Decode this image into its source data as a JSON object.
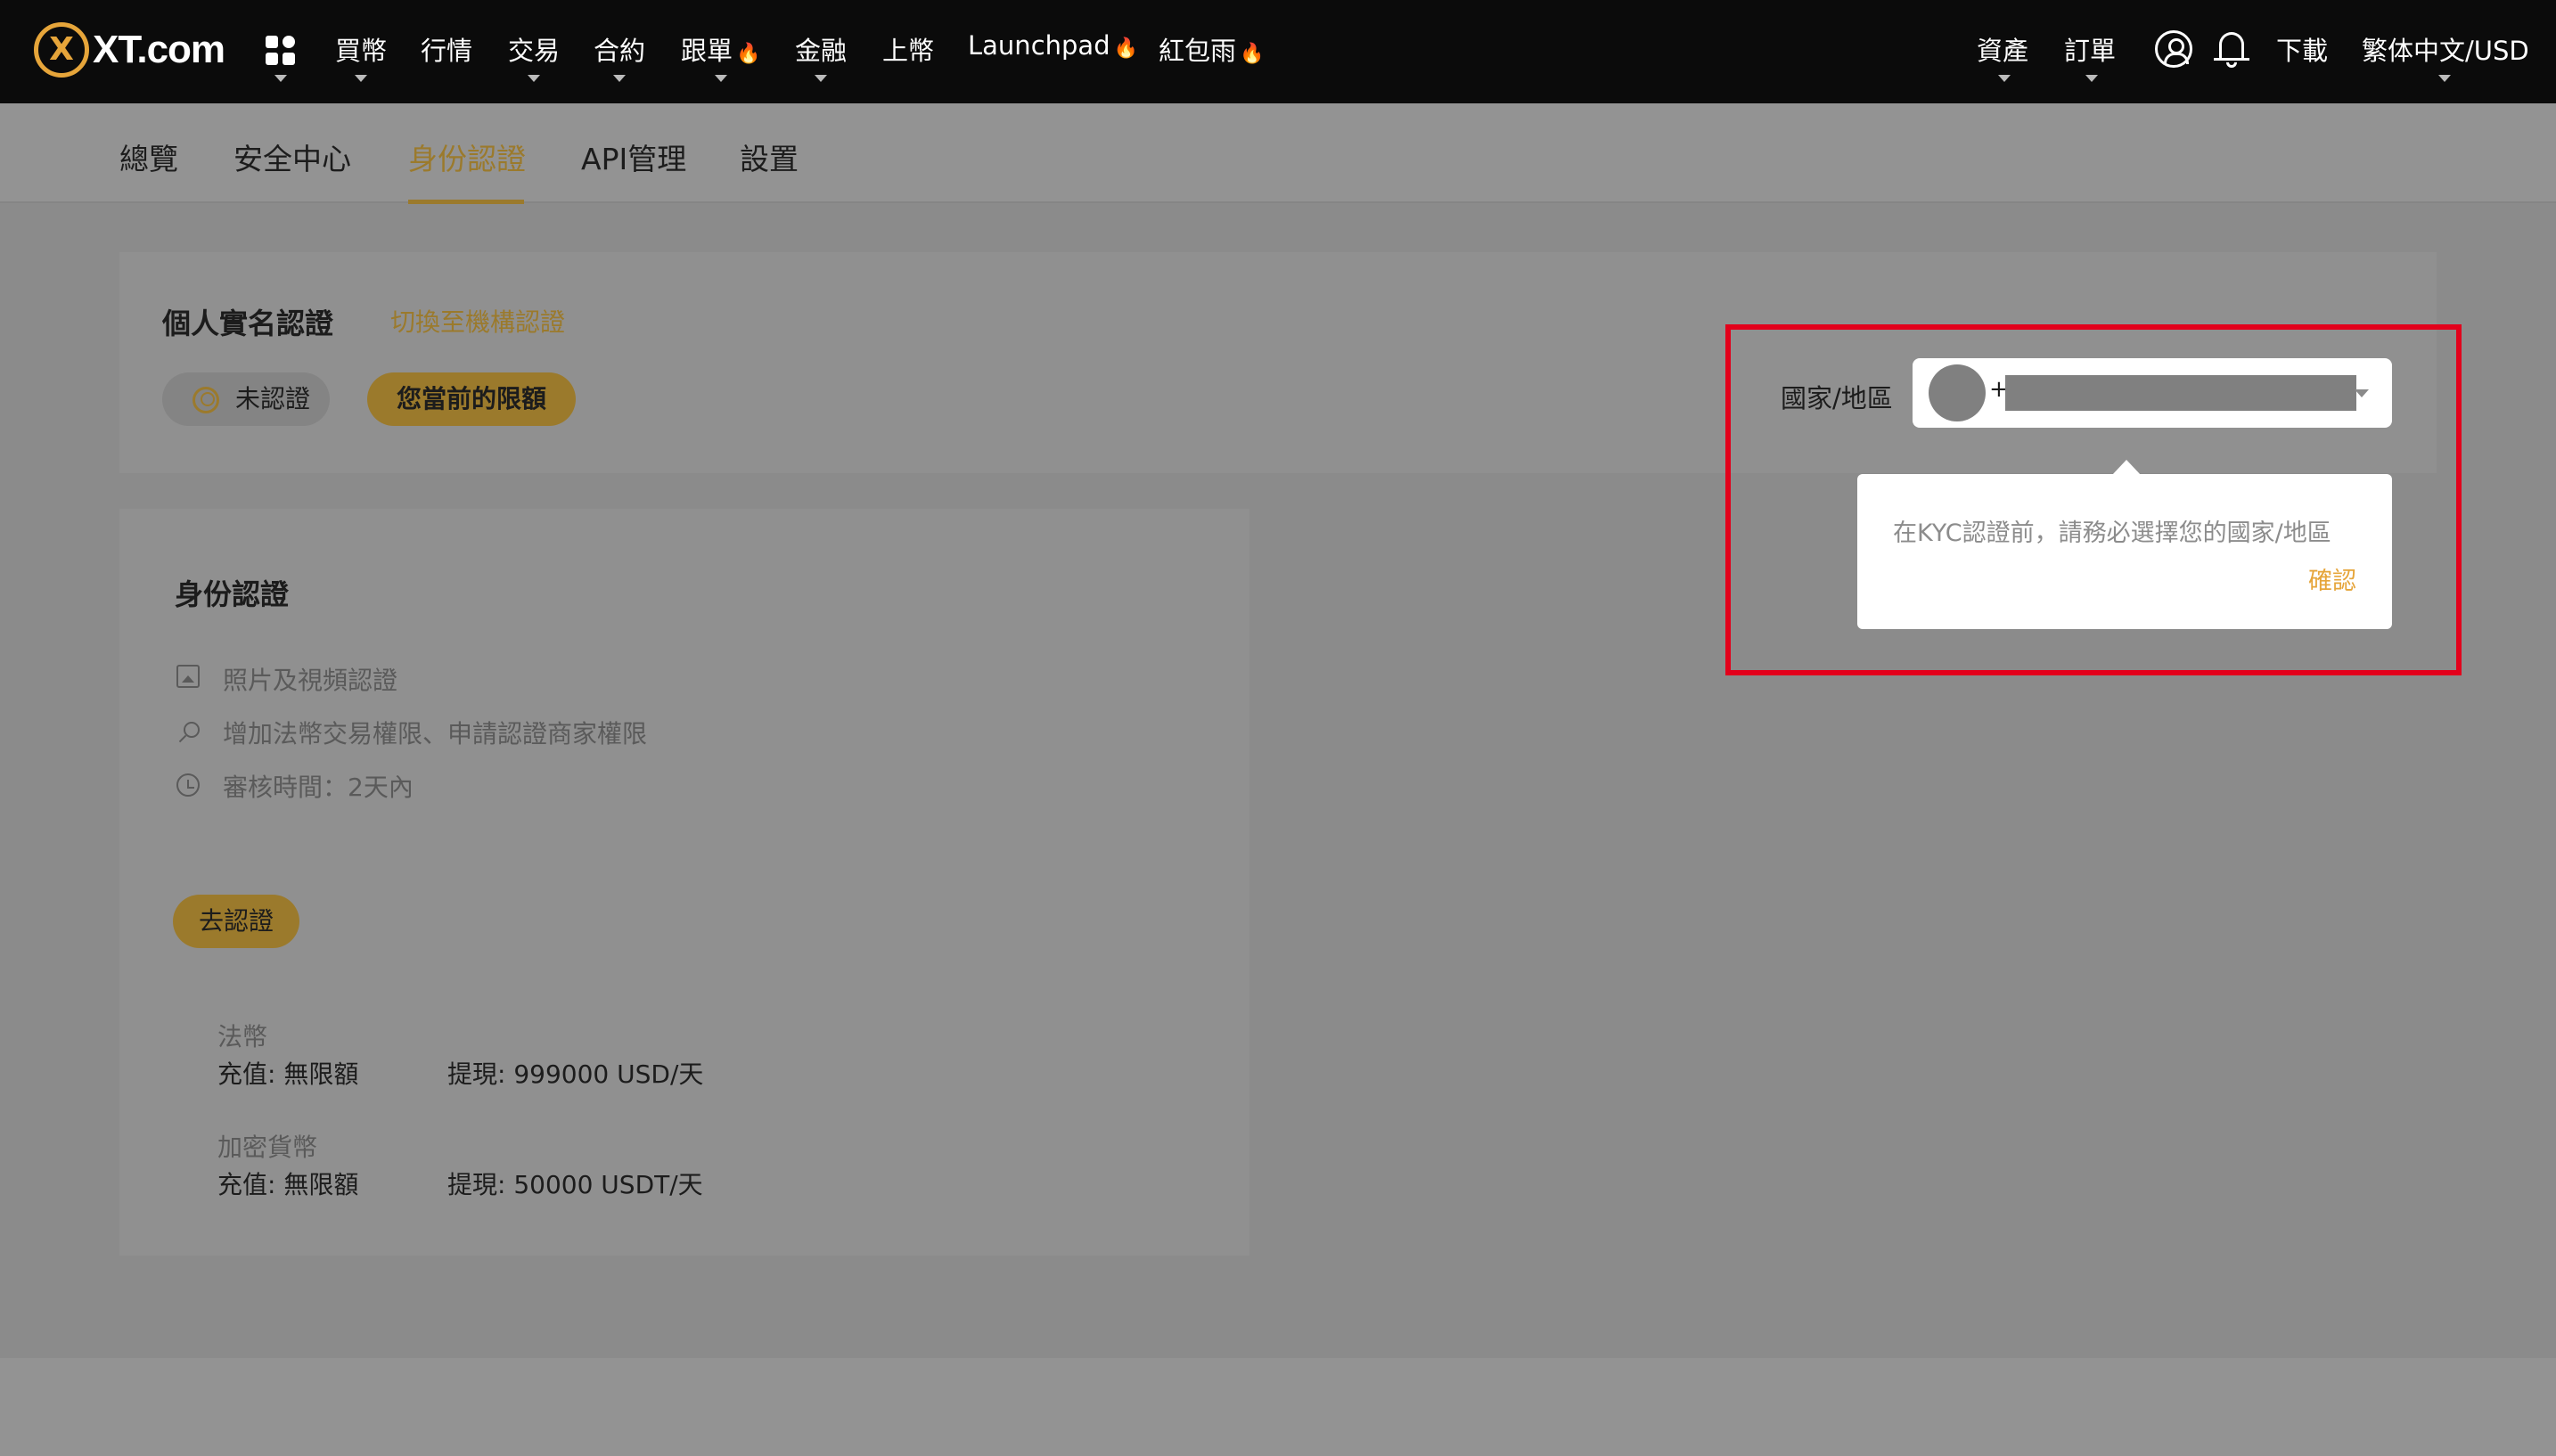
{
  "header": {
    "logo_mark": "X",
    "logo_text": "XT.com",
    "nav": [
      {
        "label": "買幣",
        "has_dropdown": true
      },
      {
        "label": "行情",
        "has_dropdown": false
      },
      {
        "label": "交易",
        "has_dropdown": true
      },
      {
        "label": "合約",
        "has_dropdown": true
      },
      {
        "label": "跟單",
        "has_dropdown": true,
        "hot": true
      },
      {
        "label": "金融",
        "has_dropdown": true
      },
      {
        "label": "上幣",
        "has_dropdown": false
      },
      {
        "label": "Launchpad",
        "has_dropdown": false,
        "hot": true
      },
      {
        "label": "紅包雨",
        "has_dropdown": false,
        "hot": true
      }
    ],
    "fire_glyph": "🔥",
    "right": {
      "assets": "資產",
      "orders": "訂單",
      "download": "下載",
      "language": "繁体中文/USD"
    }
  },
  "subnav": {
    "tabs": [
      "總覽",
      "安全中心",
      "身份認證",
      "API管理",
      "設置"
    ],
    "active_index": 2
  },
  "kyc": {
    "title": "個人實名認證",
    "switch_link": "切換至機構認證",
    "status": "未認證",
    "limit_button": "您當前的限額",
    "country_label": "國家/地區",
    "phone_prefix": "+",
    "tooltip_message": "在KYC認證前，請務必選擇您的國家/地區",
    "tooltip_confirm": "確認"
  },
  "identity": {
    "title": "身份認證",
    "features": [
      {
        "icon": "image-icon",
        "text": "照片及視頻認證"
      },
      {
        "icon": "search-icon",
        "text": "增加法幣交易權限、申請認證商家權限"
      },
      {
        "icon": "clock-icon",
        "text": "審核時間：2天內"
      }
    ],
    "go_button": "去認證",
    "limits": [
      {
        "heading": "法幣",
        "deposit": "充值: 無限額",
        "withdraw": "提現: 999000 USD/天"
      },
      {
        "heading": "加密貨幣",
        "deposit": "充值: 無限額",
        "withdraw": "提現: 50000 USDT/天"
      }
    ]
  },
  "colors": {
    "accent": "#e6a53a",
    "accent_dimmed": "#9b7a2c",
    "highlight_border": "#e3001b",
    "topbar": "#0b0b0b"
  }
}
